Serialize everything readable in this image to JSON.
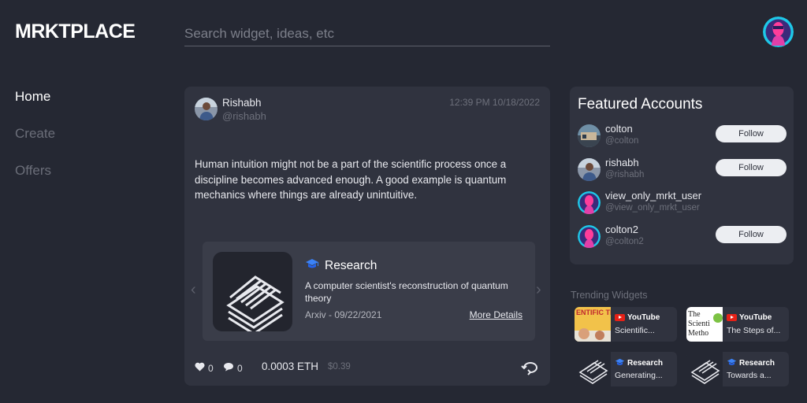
{
  "header": {
    "logo": "MRKTPLACE",
    "search_placeholder": "Search widget, ideas, etc"
  },
  "nav": {
    "items": [
      {
        "label": "Home",
        "active": true
      },
      {
        "label": "Create",
        "active": false
      },
      {
        "label": "Offers",
        "active": false
      }
    ]
  },
  "post": {
    "author_name": "Rishabh",
    "author_handle": "@rishabh",
    "timestamp": "12:39 PM 10/18/2022",
    "body": "Human intuition might not be a part of the scientific process once a discipline becomes advanced enough. A good example is quantum mechanics where things are already unintuitive.",
    "card": {
      "category": "Research",
      "title": "A computer scientist's reconstruction of quantum theory",
      "meta": "Arxiv - 09/22/2021",
      "link_label": "More Details"
    },
    "likes": "0",
    "comments": "0",
    "price_eth": "0.0003 ETH",
    "price_usd": "$0.39"
  },
  "featured": {
    "title": "Featured Accounts",
    "accounts": [
      {
        "name": "colton",
        "handle": "@colton",
        "button": "Follow"
      },
      {
        "name": "rishabh",
        "handle": "@rishabh",
        "button": "Follow"
      },
      {
        "name": "view_only_mrkt_user",
        "handle": "@view_only_mrkt_user",
        "button": ""
      },
      {
        "name": "colton2",
        "handle": "@colton2",
        "button": "Follow"
      }
    ]
  },
  "trending": {
    "title": "Trending Widgets",
    "widgets": [
      {
        "category": "YouTube",
        "title": "Scientific...",
        "thumb_text": "ENTIFIC THOD KIDS"
      },
      {
        "category": "YouTube",
        "title": "The Steps of...",
        "thumb_text": "The Scienti Metho"
      },
      {
        "category": "Research",
        "title": "Generating..."
      },
      {
        "category": "Research",
        "title": "Towards a..."
      }
    ]
  },
  "colors": {
    "background": "#252833",
    "panel": "#30333f",
    "card": "#3a3d49",
    "accent_blue": "#3b82f6"
  }
}
